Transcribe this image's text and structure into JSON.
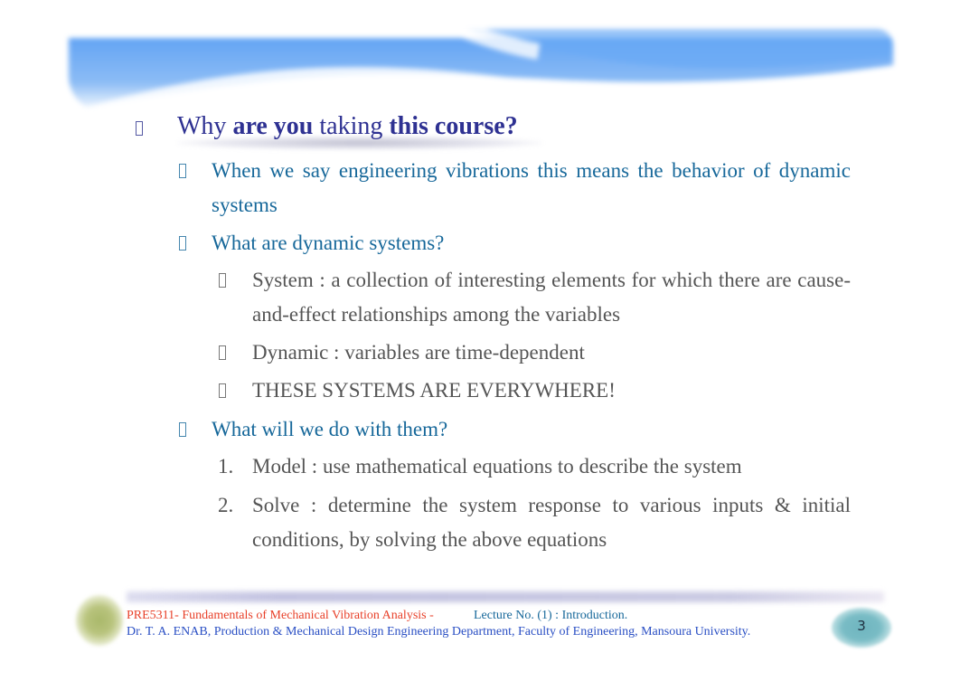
{
  "slide": {
    "title_parts": [
      {
        "text": "Why ",
        "bold": false
      },
      {
        "text": "are you",
        "bold": true
      },
      {
        "text": " taking ",
        "bold": false
      },
      {
        "text": "this course?",
        "bold": true
      }
    ],
    "bullets": [
      {
        "level": 1,
        "text": "When we say engineering vibrations  this means the behavior of dynamic systems"
      },
      {
        "level": 1,
        "text": "What are dynamic systems?"
      },
      {
        "level": 2,
        "text": "System : a collection of interesting elements for which there are cause-and-effect relationships among the variables"
      },
      {
        "level": 2,
        "text": "Dynamic : variables are time-dependent"
      },
      {
        "level": 2,
        "text": "THESE SYSTEMS ARE EVERYWHERE!"
      },
      {
        "level": 1,
        "text": "What will we do with them?"
      }
    ],
    "numbered": [
      {
        "label": "1.",
        "text": "Model : use mathematical equations to describe the system"
      },
      {
        "label": "2.",
        "text": "Solve : determine the system response to various inputs & initial conditions, by solving the above equations"
      }
    ],
    "bullet_icon": "square-bullet-icon"
  },
  "footer": {
    "course": "PRE5311- Fundamentals of Mechanical Vibration Analysis -",
    "lecture": "Lecture No. (1) : Introduction.",
    "author": "Dr. T. A. ENAB, Production & Mechanical Design Engineering Department, Faculty of Engineering, Mansoura University.",
    "page_number": "3"
  },
  "colors": {
    "title": "#2e3192",
    "level1": "#17689a",
    "level2": "#555555",
    "footer_course": "#e8412a",
    "footer_author": "#2a4fc4",
    "banner_blue": "#6aaaf5",
    "page_badge": "#6fb5bf"
  }
}
